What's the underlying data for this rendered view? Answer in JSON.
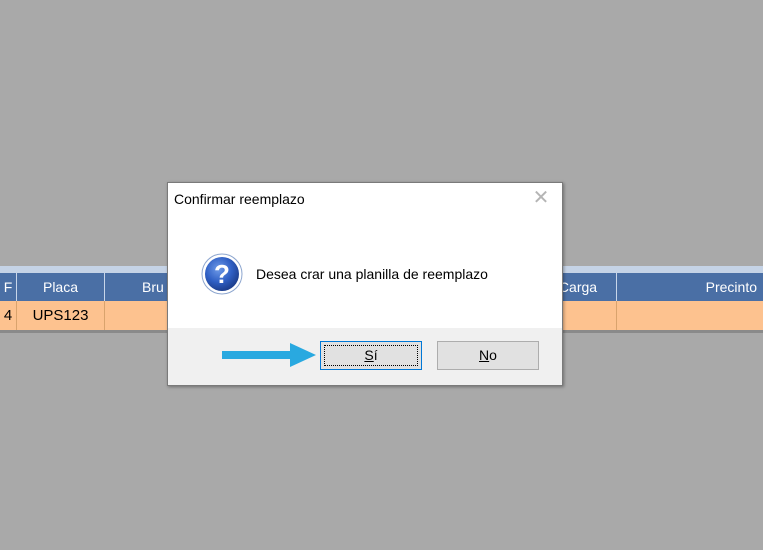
{
  "grid": {
    "headers": [
      "F",
      "Placa",
      "Bru",
      "Carga",
      "Precinto"
    ],
    "row": {
      "first": "4",
      "placa": "UPS123"
    }
  },
  "dialog": {
    "title": "Confirmar reemplazo",
    "message": "Desea crar una planilla de reemplazo",
    "icon": "question-icon",
    "close_icon": "close-icon",
    "buttons": {
      "yes": {
        "mnemonic": "S",
        "rest": "í"
      },
      "no": {
        "mnemonic": "N",
        "rest": "o"
      }
    }
  },
  "annotation": {
    "icon": "arrow-right-icon",
    "color": "#29a9e0"
  },
  "colors": {
    "background": "#a9a9a9",
    "grid_header": "#4a6fa5",
    "grid_row": "#fdc28f",
    "button_focus": "#0078d7"
  }
}
